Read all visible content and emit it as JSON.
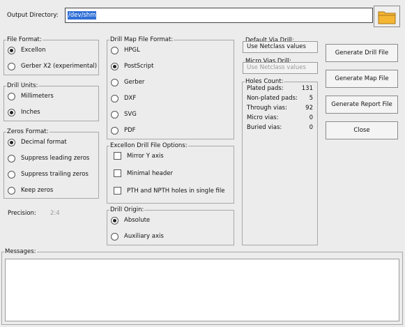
{
  "output": {
    "label": "Output Directory:",
    "value": "/dev/shm"
  },
  "file_format": {
    "title": "File Format:",
    "options": [
      {
        "label": "Excellon",
        "checked": true
      },
      {
        "label": "Gerber X2 (experimental)",
        "checked": false
      }
    ]
  },
  "drill_units": {
    "title": "Drill Units:",
    "options": [
      {
        "label": "Millimeters",
        "checked": false
      },
      {
        "label": "Inches",
        "checked": true
      }
    ]
  },
  "zeros_format": {
    "title": "Zeros Format:",
    "options": [
      {
        "label": "Decimal format",
        "checked": true
      },
      {
        "label": "Suppress leading zeros",
        "checked": false
      },
      {
        "label": "Suppress trailing zeros",
        "checked": false
      },
      {
        "label": "Keep zeros",
        "checked": false
      }
    ]
  },
  "precision": {
    "label": "Precision:",
    "value": "2:4"
  },
  "drill_map": {
    "title": "Drill Map File Format:",
    "options": [
      {
        "label": "HPGL",
        "checked": false
      },
      {
        "label": "PostScript",
        "checked": true
      },
      {
        "label": "Gerber",
        "checked": false
      },
      {
        "label": "DXF",
        "checked": false
      },
      {
        "label": "SVG",
        "checked": false
      },
      {
        "label": "PDF",
        "checked": false
      }
    ]
  },
  "excellon_options": {
    "title": "Excellon Drill File Options:",
    "options": [
      {
        "label": "Mirror Y axis",
        "checked": false
      },
      {
        "label": "Minimal header",
        "checked": false
      },
      {
        "label": "PTH and NPTH holes in single file",
        "checked": false
      }
    ]
  },
  "drill_origin": {
    "title": "Drill Origin:",
    "options": [
      {
        "label": "Absolute",
        "checked": true
      },
      {
        "label": "Auxiliary axis",
        "checked": false
      }
    ]
  },
  "default_via": {
    "title": "Default Via Drill:",
    "value": "Use Netclass values"
  },
  "micro_via": {
    "title": "Micro Vias Drill:",
    "value": "Use Netclass values"
  },
  "holes_count": {
    "title": "Holes Count:",
    "rows": [
      {
        "label": "Plated pads:",
        "value": "131"
      },
      {
        "label": "Non-plated pads:",
        "value": "5"
      },
      {
        "label": "Through vias:",
        "value": "92"
      },
      {
        "label": "Micro vias:",
        "value": "0"
      },
      {
        "label": "Buried vias:",
        "value": "0"
      }
    ]
  },
  "buttons": {
    "generate_drill": "Generate Drill File",
    "generate_map": "Generate Map File",
    "generate_report": "Generate Report File",
    "close": "Close"
  },
  "messages": {
    "title": "Messages:",
    "text": ""
  },
  "colors": {
    "accent": "#2f6fd6",
    "folder": "#f5b634"
  }
}
